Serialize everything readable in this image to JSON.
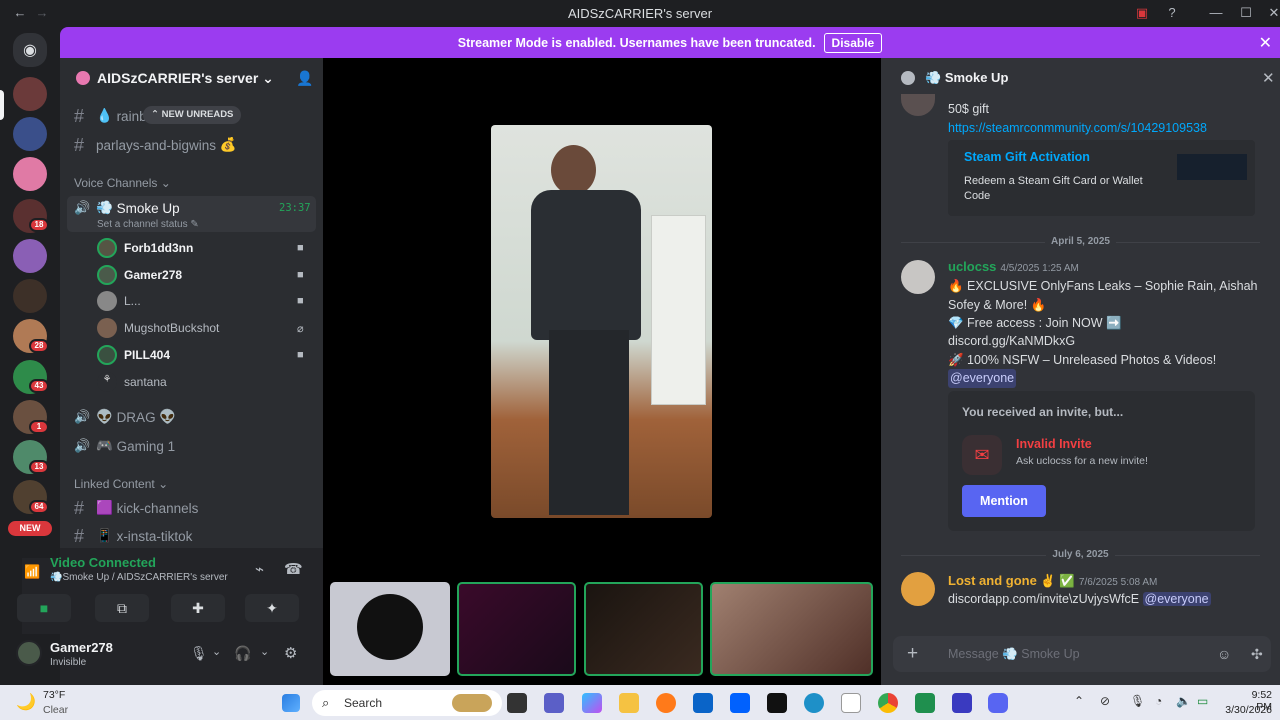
{
  "window": {
    "title": "AIDSzCARRIER's server"
  },
  "banner": {
    "text": "Streamer Mode is enabled. Usernames have been truncated.",
    "button": "Disable"
  },
  "rail": {
    "badges": [
      "18",
      "28",
      "43",
      "1",
      "13",
      "64"
    ],
    "new_label": "NEW"
  },
  "server": {
    "name": "AIDSzCARRIER's server",
    "new_unreads": "NEW UNREADS"
  },
  "channels": {
    "rainbow": "rainb",
    "parlays": "parlays-and-bigwins",
    "voice_category": "Voice Channels",
    "smoke_up": "Smoke Up",
    "smoke_time": "23:37",
    "status_hint": "Set a channel status",
    "users": [
      "Forb1dd3nn",
      "Gamer278",
      "L...",
      "MugshotBuckshot",
      "PILL404",
      "santana"
    ],
    "drag": "DRAG",
    "gaming": "Gaming 1",
    "linked_category": "Linked Content",
    "kick": "kick-channels",
    "insta": "x-insta-tiktok"
  },
  "voice_panel": {
    "status": "Video Connected",
    "location": "Smoke Up / AIDSzCARRIER's server"
  },
  "account": {
    "name": "Gamer278",
    "status": "Invisible"
  },
  "chat": {
    "title": "Smoke Up",
    "gift_text": "50$ gift",
    "gift_link": "https://steamrconmmunity.com/s/10429109538",
    "embed_title": "Steam Gift Activation",
    "embed_desc": "Redeem a Steam Gift Card or Wallet Code",
    "date1": "April 5, 2025",
    "m1_author": "uclocss",
    "m1_time": "4/5/2025 1:25 AM",
    "m1_l1": "EXCLUSIVE OnlyFans Leaks – Sophie Rain, Aishah Sofey & More!",
    "m1_l2": "Free access : Join NOW",
    "m1_l3": "discord.gg/KaNMDkxG",
    "m1_l4": "100% NSFW – Unreleased Photos & Videos!",
    "m1_mention": "@everyone",
    "invite_head": "You received an invite, but...",
    "invite_title": "Invalid Invite",
    "invite_sub": "Ask uclocss for a new invite!",
    "invite_btn": "Mention",
    "date2": "July 6, 2025",
    "m2_author": "Lost and gone",
    "m2_time": "7/6/2025 5:08 AM",
    "m2_text": "discordapp.com/invite\\zUvjysWfcE",
    "m2_mention": "@everyone",
    "input_placeholder": "Message 💨 Smoke Up"
  },
  "taskbar": {
    "temp": "73°F",
    "weather": "Clear",
    "search": "Search",
    "time": "9:52 PM",
    "date": "3/30/2026"
  },
  "colors": {
    "accent": "#5865f2",
    "banner": "#9b3cf0",
    "green": "#23a55a",
    "mention": "#3c4270"
  }
}
